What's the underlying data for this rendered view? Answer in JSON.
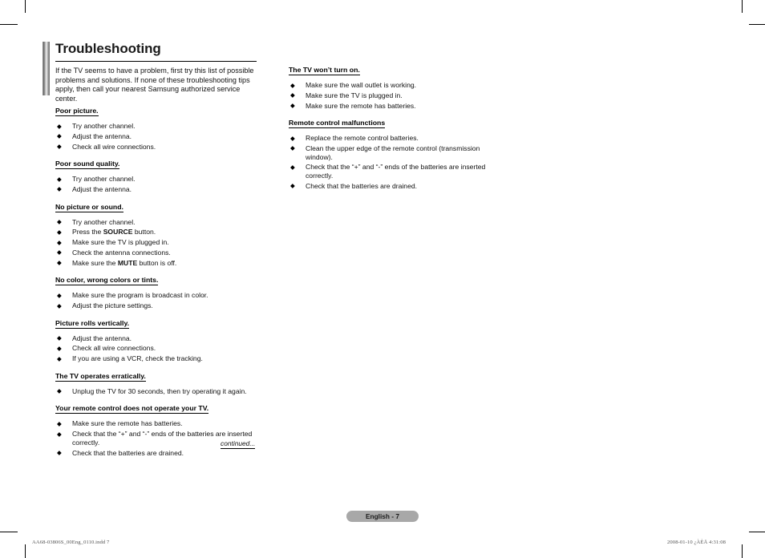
{
  "document": {
    "title": "Troubleshooting",
    "intro": "If the TV seems to have a problem, first try this list of possible problems and solutions. If none of these troubleshooting tips apply, then call your nearest Samsung authorized service center.",
    "bullet_glyph": "◆",
    "continued_label": "continued...",
    "page_badge": "English - 7"
  },
  "footer": {
    "left": "AA68-03806S_00Eng_0110.indd   7",
    "right": "2008-01-10   ¿ÀÈÄ 4:31:08"
  },
  "colors": {
    "badge_background": "#a8a8a8",
    "badge_text": "#1c1c1c",
    "rule": "#000000",
    "body_text": "#111111"
  },
  "left_column": [
    {
      "heading": "Poor picture.",
      "items": [
        [
          {
            "t": "Try another channel."
          }
        ],
        [
          {
            "t": "Adjust the antenna."
          }
        ],
        [
          {
            "t": "Check all wire connections."
          }
        ]
      ]
    },
    {
      "heading": "Poor sound quality.",
      "items": [
        [
          {
            "t": "Try another channel."
          }
        ],
        [
          {
            "t": "Adjust the antenna."
          }
        ]
      ]
    },
    {
      "heading": "No picture or sound.",
      "items": [
        [
          {
            "t": "Try another channel."
          }
        ],
        [
          {
            "t": "Press the "
          },
          {
            "t": "SOURCE",
            "bold": true
          },
          {
            "t": " button."
          }
        ],
        [
          {
            "t": "Make sure the TV is plugged in."
          }
        ],
        [
          {
            "t": "Check the antenna connections."
          }
        ],
        [
          {
            "t": "Make sure the "
          },
          {
            "t": "MUTE",
            "bold": true
          },
          {
            "t": " button is off."
          }
        ]
      ]
    },
    {
      "heading": "No color, wrong colors or tints.",
      "items": [
        [
          {
            "t": "Make sure the program is broadcast in color."
          }
        ],
        [
          {
            "t": "Adjust the picture settings."
          }
        ]
      ]
    },
    {
      "heading": "Picture rolls vertically.",
      "items": [
        [
          {
            "t": "Adjust the antenna."
          }
        ],
        [
          {
            "t": "Check all wire connections."
          }
        ],
        [
          {
            "t": "If you are using a VCR, check the tracking."
          }
        ]
      ]
    },
    {
      "heading": "The TV operates erratically.",
      "items": [
        [
          {
            "t": "Unplug the TV for 30 seconds, then try operating it again."
          }
        ]
      ]
    },
    {
      "heading": "Your remote control does not operate your TV.",
      "items": [
        [
          {
            "t": "Make sure the remote has batteries."
          }
        ],
        [
          {
            "t": "Check that the “+” and “-” ends of the batteries are inserted correctly."
          }
        ],
        [
          {
            "t": "Check that the batteries are drained."
          }
        ]
      ]
    }
  ],
  "right_column": [
    {
      "heading": "The TV won’t turn on.",
      "items": [
        [
          {
            "t": "Make sure the wall outlet is working."
          }
        ],
        [
          {
            "t": "Make sure the TV is plugged in."
          }
        ],
        [
          {
            "t": "Make sure the remote has batteries."
          }
        ]
      ]
    },
    {
      "heading": "Remote control malfunctions",
      "items": [
        [
          {
            "t": "Replace the remote control batteries."
          }
        ],
        [
          {
            "t": "Clean the upper edge of the remote control (transmission window)."
          }
        ],
        [
          {
            "t": "Check that the “+” and “-” ends of the batteries are inserted correctly."
          }
        ],
        [
          {
            "t": "Check that the batteries are drained."
          }
        ]
      ]
    }
  ]
}
